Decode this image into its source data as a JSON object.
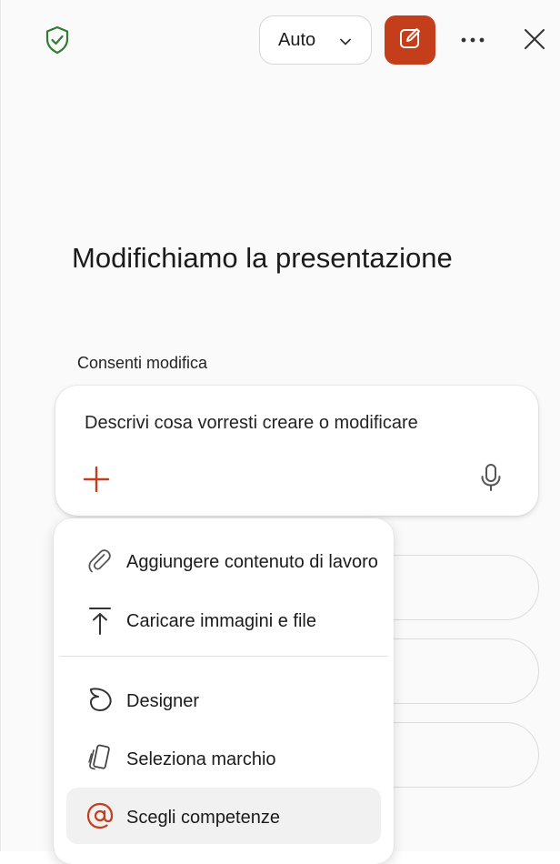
{
  "header": {
    "mode_select": {
      "value": "Auto"
    }
  },
  "main": {
    "heading": "Modifichiamo la presentazione",
    "allow_label": "Consenti modifica",
    "composer": {
      "placeholder": "Descrivi cosa vorresti creare o modificare"
    }
  },
  "menu": {
    "items": [
      {
        "label": "Aggiungere contenuto di lavoro",
        "icon": "paperclip-icon"
      },
      {
        "label": "Caricare immagini e file",
        "icon": "upload-icon"
      },
      {
        "label": "Designer",
        "icon": "designer-icon"
      },
      {
        "label": "Seleziona marchio",
        "icon": "brand-icon"
      },
      {
        "label": "Scegli competenze",
        "icon": "at-sign-icon"
      }
    ]
  },
  "colors": {
    "accent": "#c43e1c",
    "shield": "#2e7d32",
    "text": "#1b1b1b"
  }
}
